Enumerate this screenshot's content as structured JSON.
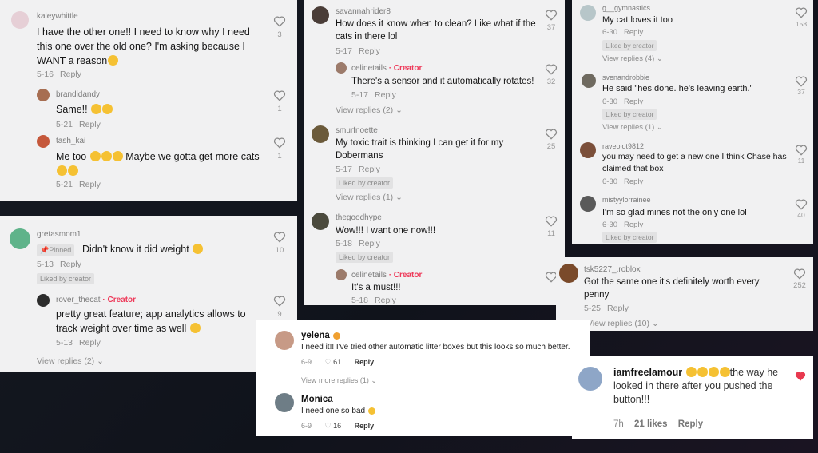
{
  "card1": {
    "c1": {
      "user": "kaleywhittle",
      "text": "I have the other one!! I need to know why I need this one over the old one? I'm asking because I WANT a reason",
      "date": "5-16",
      "reply": "Reply",
      "likes": "3"
    },
    "c2": {
      "user": "brandidandy",
      "text": "Same!!",
      "date": "5-21",
      "reply": "Reply",
      "likes": "1"
    },
    "c3": {
      "user": "tash_kai",
      "text": "Me too",
      "text2": "Maybe we gotta get more cats",
      "date": "5-21",
      "reply": "Reply",
      "likes": "1"
    }
  },
  "card2": {
    "c1": {
      "user": "gretasmom1",
      "pinned": "Pinned",
      "text": "Didn't know it did weight",
      "date": "5-13",
      "reply": "Reply",
      "liked": "Liked by creator",
      "likes": "10"
    },
    "c2": {
      "user": "rover_thecat",
      "creator": "· Creator",
      "text": "pretty great feature; app analytics allows to track weight over time as well",
      "date": "5-13",
      "reply": "Reply",
      "likes": "9"
    },
    "views": "View replies (2)"
  },
  "card3": {
    "c1": {
      "user": "savannahrider8",
      "text": "How does it know when to clean? Like what if the cats in there lol",
      "date": "5-17",
      "reply": "Reply",
      "likes": "37"
    },
    "c2": {
      "user": "celinetails",
      "creator": "· Creator",
      "text": "There's a sensor and it automatically rotates!",
      "date": "5-17",
      "reply": "Reply",
      "likes": "32"
    },
    "views1": "View replies (2)",
    "c3": {
      "user": "smurfnoette",
      "text": "My toxic trait is thinking I can get it for my Dobermans",
      "date": "5-17",
      "reply": "Reply",
      "liked": "Liked by creator",
      "likes": "25"
    },
    "views2": "View replies (1)",
    "c4": {
      "user": "thegoodhype",
      "text": "Wow!!! I want one now!!!",
      "date": "5-18",
      "reply": "Reply",
      "liked": "Liked by creator",
      "likes": "11"
    },
    "c5": {
      "user": "celinetails",
      "creator": "· Creator",
      "text": "It's a must!!!",
      "date": "5-18",
      "reply": "Reply"
    }
  },
  "card4": {
    "c1": {
      "user": "g__gymnastics",
      "text": "My cat loves it too",
      "date": "6-30",
      "reply": "Reply",
      "liked": "Liked by creator",
      "likes": "158"
    },
    "views1": "View replies (4)",
    "c2": {
      "user": "svenandrobbie",
      "text": "He said \"hes done. he's leaving earth.\"",
      "date": "6-30",
      "reply": "Reply",
      "liked": "Liked by creator",
      "likes": "37"
    },
    "views2": "View replies (1)",
    "c3": {
      "user": "raveolot9812",
      "text": "you may need to get a new one I think Chase has claimed that box",
      "date": "6-30",
      "reply": "Reply",
      "likes": "11"
    },
    "c4": {
      "user": "mistyylorrainee",
      "text": "I'm so glad mines not the only one lol",
      "date": "6-30",
      "reply": "Reply",
      "liked": "Liked by creator",
      "likes": "40"
    }
  },
  "card5": {
    "c1": {
      "user": "tsk5227_.roblox",
      "text": "Got the same one it's definitely worth every penny",
      "date": "5-25",
      "reply": "Reply",
      "likes": "252"
    },
    "views": "View replies (10)"
  },
  "card6": {
    "c1": {
      "user": "yelena",
      "text": "I need it!! I've tried other automatic litter boxes but this looks so much better.",
      "date": "6-9",
      "likes": "61",
      "reply": "Reply"
    },
    "views": "View more replies (1)",
    "c2": {
      "user": "Monica",
      "text": "I need one so bad",
      "date": "6-9",
      "likes": "16",
      "reply": "Reply"
    }
  },
  "card7": {
    "c1": {
      "user": "iamfreelamour",
      "text": "the way he looked in there after you pushed the button!!!",
      "date": "7h",
      "likes": "21 likes",
      "reply": "Reply"
    }
  },
  "colors": {
    "creator": "#ee3a5a",
    "heart_active": "#e8394f",
    "background": "#12151d"
  }
}
